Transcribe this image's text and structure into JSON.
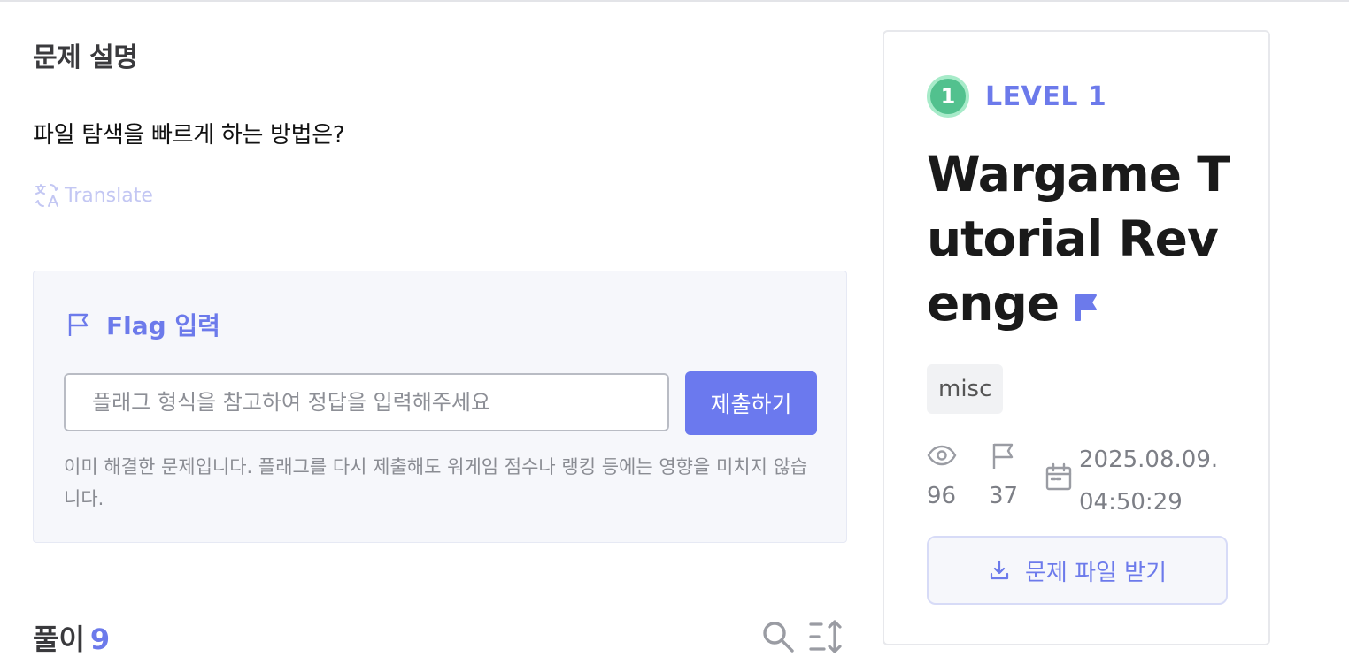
{
  "description": {
    "section_title": "문제 설명",
    "question": "파일 탐색을 빠르게 하는 방법은?",
    "translate_label": "Translate"
  },
  "flag": {
    "title": "Flag 입력",
    "input_value": "",
    "input_placeholder": "플래그 형식을 참고하여 정답을 입력해주세요",
    "submit_label": "제출하기",
    "solved_note": "이미 해결한 문제입니다. 플래그를 다시 제출해도 워게임 점수나 랭킹 등에는 영향을 미치지 않습니다."
  },
  "solutions": {
    "label": "풀이",
    "count": "9"
  },
  "challenge": {
    "level_number": "1",
    "level_label": "LEVEL 1",
    "title": "Wargame Tutorial Revenge",
    "tag": "misc",
    "views": "96",
    "solves": "37",
    "date": "2025.08.09.",
    "time": "04:50:29",
    "download_label": "문제 파일 받기"
  },
  "colors": {
    "accent": "#6b79ee",
    "level_badge": "#52c18e",
    "muted": "#7d7f86"
  },
  "icons": [
    "translate-icon",
    "flag-outline-icon",
    "search-icon",
    "sort-icon",
    "flag-filled-icon",
    "eye-icon",
    "calendar-icon",
    "download-icon"
  ]
}
